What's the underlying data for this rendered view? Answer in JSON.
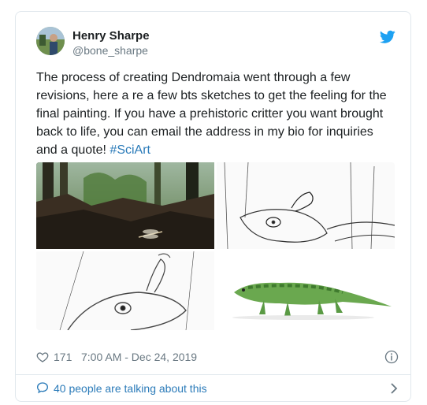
{
  "author": {
    "name": "Henry Sharpe",
    "handle": "@bone_sharpe"
  },
  "tweet": {
    "text": "The process of creating Dendromaia went through a few\nrevisions, here a re a few bts sketches to get the feeling for the\nfinal painting. If you have a prehistoric critter you want brought\nback to life, you can email the address in my bio for inquiries\nand a quote! ",
    "hashtag": "#SciArt"
  },
  "media": [
    {
      "icon": "painting-forest-dragonfly"
    },
    {
      "icon": "sketch-lizard-on-head"
    },
    {
      "icon": "sketch-lizard-closeup"
    },
    {
      "icon": "green-lizard-painting"
    }
  ],
  "meta": {
    "likes": "171",
    "timestamp": "7:00 AM - Dec 24, 2019"
  },
  "footer": {
    "talking": "40 people are talking about this"
  },
  "colors": {
    "link": "#2b7bb9",
    "muted": "#697882",
    "twitter_blue": "#1da1f2"
  }
}
